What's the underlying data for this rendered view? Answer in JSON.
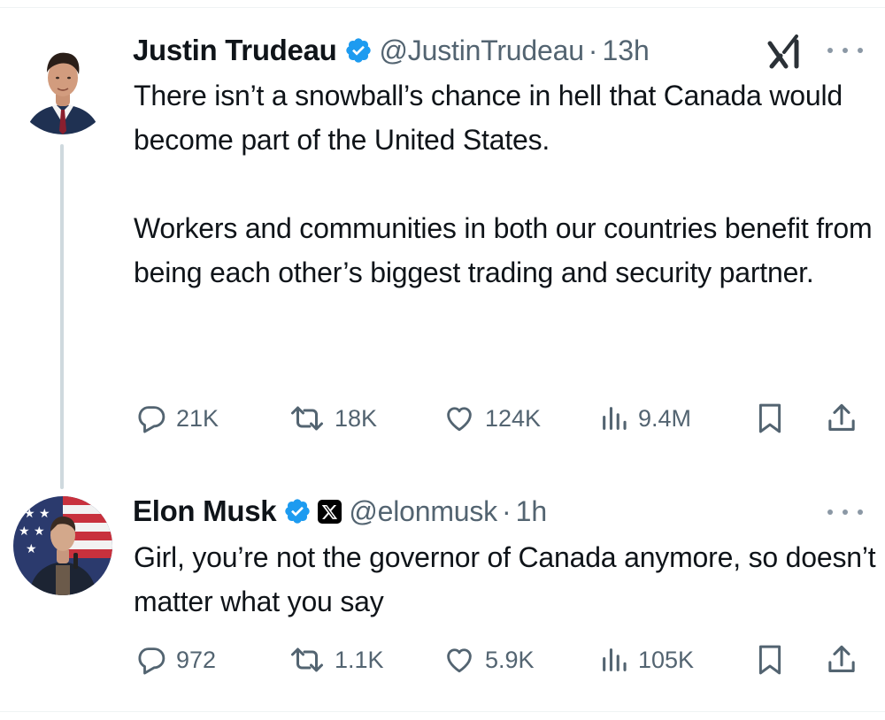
{
  "tweets": [
    {
      "display_name": "Justin Trudeau",
      "verified": true,
      "handle": "@JustinTrudeau",
      "separator": "·",
      "time": "13h",
      "paragraphs": [
        "There isn’t a snowball’s chance in hell that Canada would become part of the United States.",
        "Workers and communities in both our countries benefit from being each other’s biggest trading and security partner."
      ],
      "stats": {
        "replies": "21K",
        "reposts": "18K",
        "likes": "124K",
        "views": "9.4M"
      }
    },
    {
      "display_name": "Elon Musk",
      "verified": true,
      "affiliate_badge": "X",
      "handle": "@elonmusk",
      "separator": "·",
      "time": "1h",
      "paragraphs": [
        "Girl, you’re not the governor of Canada anymore, so doesn’t matter what you say"
      ],
      "stats": {
        "replies": "972",
        "reposts": "1.1K",
        "likes": "5.9K",
        "views": "105K"
      }
    }
  ],
  "icons": {
    "reply": "reply-icon",
    "repost": "repost-icon",
    "like": "heart-icon",
    "views": "views-icon",
    "bookmark": "bookmark-icon",
    "share": "share-icon",
    "more": "more-icon",
    "grok": "grok-icon",
    "verified": "verified-badge-icon"
  },
  "colors": {
    "verified": "#1d9bf0",
    "muted": "#536471",
    "text": "#0f1419",
    "thread_line": "#cfd9de"
  }
}
